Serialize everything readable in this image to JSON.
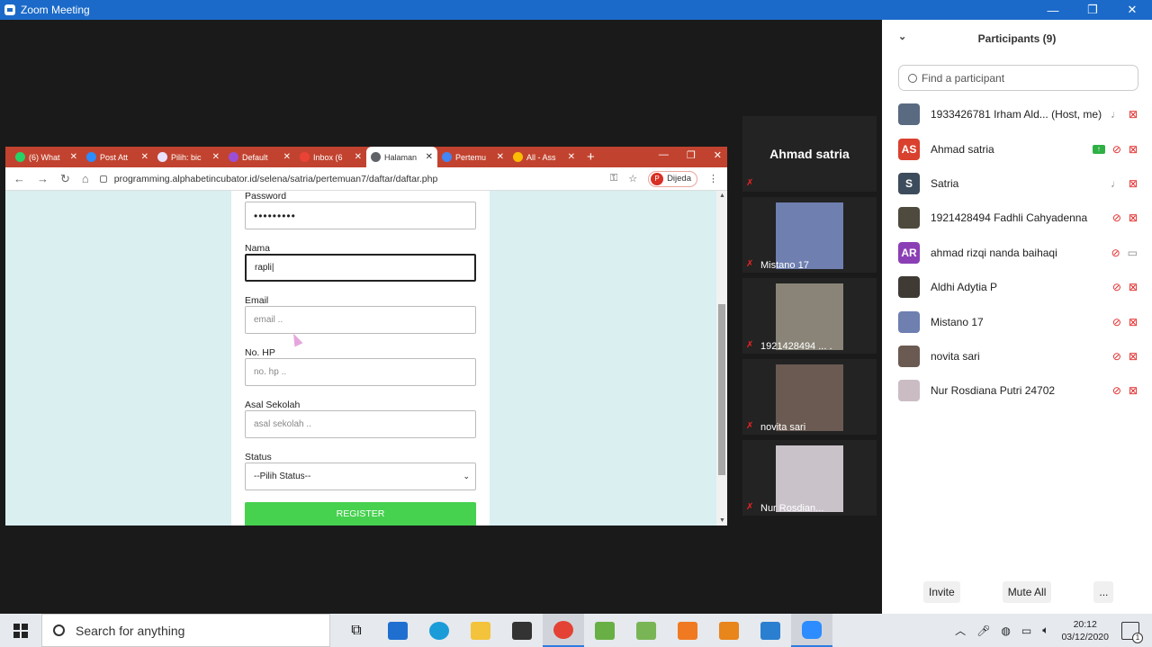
{
  "window": {
    "title": "Zoom Meeting",
    "min": "—",
    "max": "❐",
    "close": "✕"
  },
  "browser": {
    "tabs": [
      {
        "label": "(6) What",
        "color": "#25d366"
      },
      {
        "label": "Post Att",
        "color": "#2d8cff"
      },
      {
        "label": "Pilih: bic",
        "color": "#e9e3ff"
      },
      {
        "label": "Default",
        "color": "#9c4fd6"
      },
      {
        "label": "Inbox (6",
        "color": "#ea4335"
      },
      {
        "label": "Halaman",
        "color": "#5f6368"
      },
      {
        "label": "Pertemu",
        "color": "#4285f4"
      },
      {
        "label": "All - Ass",
        "color": "#fbbc04"
      }
    ],
    "new_tab": "+",
    "close_tab": "✕",
    "url": "programming.alphabetincubator.id/selena/satria/pertemuan7/daftar/daftar.php",
    "profile_initial": "P",
    "profile_status": "Dijeda"
  },
  "form": {
    "password_label": "Password",
    "password_value": "•••••••••",
    "nama_label": "Nama",
    "nama_value": "rapli",
    "email_label": "Email",
    "email_placeholder": "email ..",
    "hp_label": "No. HP",
    "hp_placeholder": "no. hp ..",
    "sekolah_label": "Asal Sekolah",
    "sekolah_placeholder": "asal sekolah ..",
    "status_label": "Status",
    "status_selected": "--Pilih Status--",
    "register_label": "REGISTER"
  },
  "videos": {
    "speaker": "Ahmad satria",
    "tiles": [
      {
        "name": "Mistano 17",
        "color": "#6e7fb0"
      },
      {
        "name": "1921428494 ... .",
        "color": "#8a8478"
      },
      {
        "name": "novita sari",
        "color": "#6b5a52"
      },
      {
        "name": "Nur Rosdian...",
        "color": "#c9c2c9"
      }
    ]
  },
  "participants": {
    "title": "Participants (9)",
    "search_placeholder": "Find a participant",
    "list": [
      {
        "name": "1933426781 Irham Ald... (Host, me)",
        "avatar": "",
        "avatar_color": "#5a6a80",
        "mic": "on",
        "video": "off"
      },
      {
        "name": "Ahmad satria",
        "avatar": "AS",
        "avatar_color": "#d9412e",
        "mic": "off",
        "video": "off",
        "sharing": true
      },
      {
        "name": "Satria",
        "avatar": "S",
        "avatar_color": "#3d4c5c",
        "mic": "on",
        "video": "off"
      },
      {
        "name": "1921428494 Fadhli Cahyadenna",
        "avatar": "",
        "avatar_color": "#4e4a3e",
        "mic": "off",
        "video": "off"
      },
      {
        "name": "ahmad rizqi nanda baihaqi",
        "avatar": "AR",
        "avatar_color": "#8b3fb5",
        "mic": "off",
        "video": "on"
      },
      {
        "name": "Aldhi Adytia P",
        "avatar": "",
        "avatar_color": "#3f3a34",
        "mic": "off",
        "video": "off"
      },
      {
        "name": "Mistano 17",
        "avatar": "",
        "avatar_color": "#6e7fb0",
        "mic": "off",
        "video": "off"
      },
      {
        "name": "novita sari",
        "avatar": "",
        "avatar_color": "#6b5a52",
        "mic": "off",
        "video": "off"
      },
      {
        "name": "Nur Rosdiana Putri 24702",
        "avatar": "",
        "avatar_color": "#cbbcc4",
        "mic": "off",
        "video": "off"
      }
    ],
    "invite": "Invite",
    "mute_all": "Mute All",
    "more": "..."
  },
  "taskbar": {
    "search": "Search for anything",
    "time": "20:12",
    "date": "03/12/2020",
    "notif_count": "1"
  }
}
